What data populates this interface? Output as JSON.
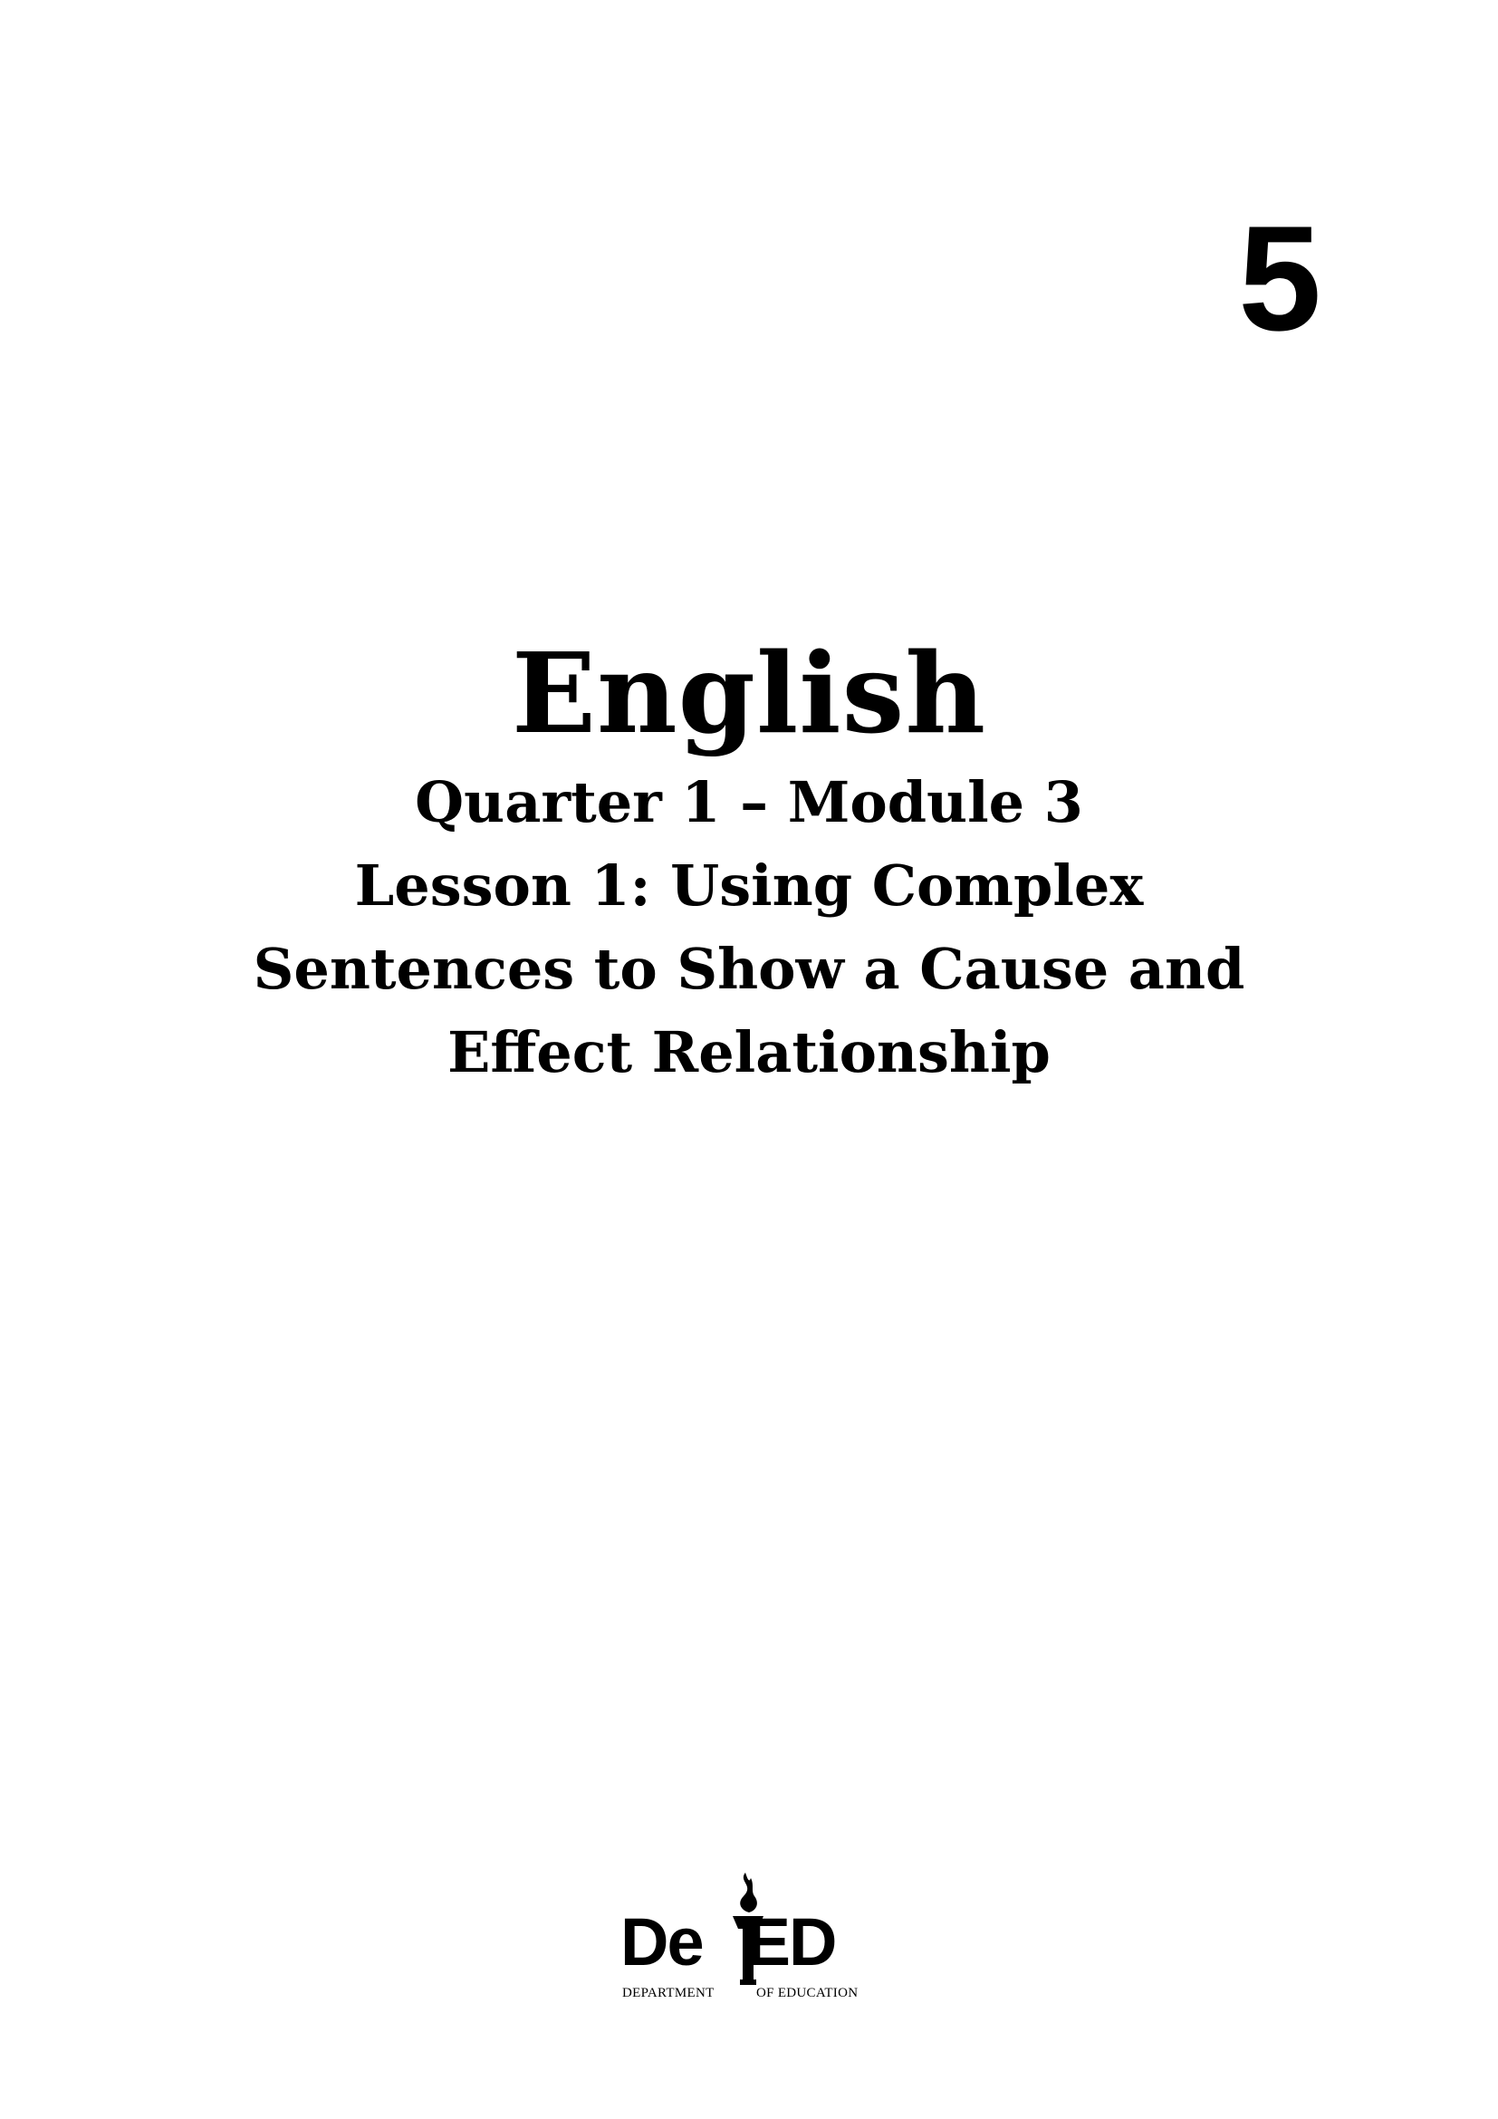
{
  "cover": {
    "grade": "5",
    "subject": "English",
    "quarter_module": "Quarter 1 – Module 3",
    "lesson_lines": [
      "Lesson 1: Using Complex",
      "Sentences to Show a Cause and",
      "Effect Relationship"
    ]
  },
  "logo": {
    "word_left": "De",
    "word_right": "ED",
    "sub_left": "DEPARTMENT",
    "sub_right": "OF EDUCATION",
    "icon": "torch-icon"
  }
}
